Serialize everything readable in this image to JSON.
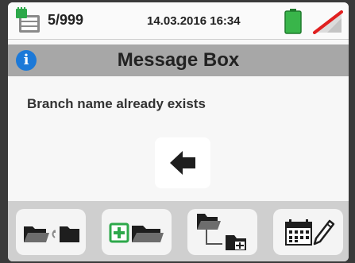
{
  "status": {
    "memory_icon": "memory-card-icon",
    "memory_count": "5/999",
    "datetime": "14.03.2016  16:34",
    "battery_icon": "battery-icon",
    "battery_level": 1.0,
    "wifi_icon": "wifi-off-icon"
  },
  "titlebar": {
    "icon": "info-icon",
    "icon_glyph": "i",
    "title": "Message Box"
  },
  "message": {
    "text": "Branch name already exists"
  },
  "back_button": {
    "icon": "back-arrow-icon"
  },
  "toolbar": {
    "buttons": [
      {
        "icon": "move-folder-icon"
      },
      {
        "icon": "add-folder-icon"
      },
      {
        "icon": "add-subfolder-icon"
      },
      {
        "icon": "calendar-edit-icon"
      }
    ]
  },
  "colors": {
    "title_bar": "#a7a7a7",
    "info_icon": "#1c79d8",
    "battery": "#39b54a",
    "wifi_off": "#e02020"
  }
}
